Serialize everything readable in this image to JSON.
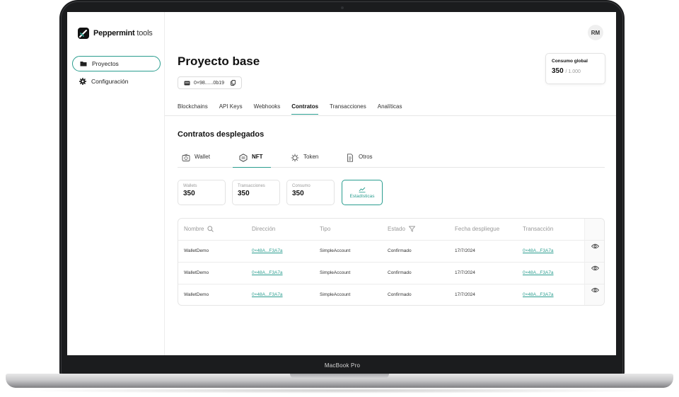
{
  "device": {
    "label": "MacBook Pro"
  },
  "sidebar": {
    "logo": {
      "brand": "Peppermint",
      "suffix": "tools"
    },
    "items": [
      {
        "label": "Proyectos",
        "icon": "folder-icon",
        "active": true
      },
      {
        "label": "Configuración",
        "icon": "gear-icon",
        "active": false
      }
    ]
  },
  "header": {
    "avatar": "RM",
    "title": "Proyecto base",
    "address": "0×98......0b19",
    "consumo": {
      "label": "Consumo global",
      "value": "350",
      "max": "/ 1.000"
    }
  },
  "tabs": [
    {
      "label": "Blockchains"
    },
    {
      "label": "API Keys"
    },
    {
      "label": "Webhooks"
    },
    {
      "label": "Contratos",
      "active": true
    },
    {
      "label": "Transacciones"
    },
    {
      "label": "Analíticas"
    }
  ],
  "section": {
    "title": "Contratos desplegados"
  },
  "subtabs": [
    {
      "label": "Wallet",
      "icon": "wallet-icon"
    },
    {
      "label": "NFT",
      "icon": "nft-icon",
      "active": true
    },
    {
      "label": "Token",
      "icon": "token-icon"
    },
    {
      "label": "Otros",
      "icon": "document-icon"
    }
  ],
  "stats": [
    {
      "label": "Wallets",
      "value": "350"
    },
    {
      "label": "Transacciones",
      "value": "350"
    },
    {
      "label": "Consumo",
      "value": "350"
    }
  ],
  "stats_button": {
    "label": "Estadísticas",
    "icon": "chart-icon"
  },
  "table": {
    "columns": [
      "Nombre",
      "Dirección",
      "Tipo",
      "Estado",
      "Fecha despliegue",
      "Transacción"
    ],
    "rows": [
      [
        "WalletDemo",
        "0×48A...F3A7a",
        "SimpleAccount",
        "Confirmado",
        "17/7/2024",
        "0×48A...F3A7a"
      ],
      [
        "WalletDemo",
        "0×48A...F3A7a",
        "SimpleAccount",
        "Confirmado",
        "17/7/2024",
        "0×48A...F3A7a"
      ],
      [
        "WalletDemo",
        "0×48A...F3A7a",
        "SimpleAccount",
        "Confirmado",
        "17/7/2024",
        "0×48A...F3A7a"
      ]
    ]
  },
  "colors": {
    "accent": "#2a9d8f",
    "text": "#111111",
    "muted": "#999999",
    "bezel": "#1b1c1e"
  }
}
